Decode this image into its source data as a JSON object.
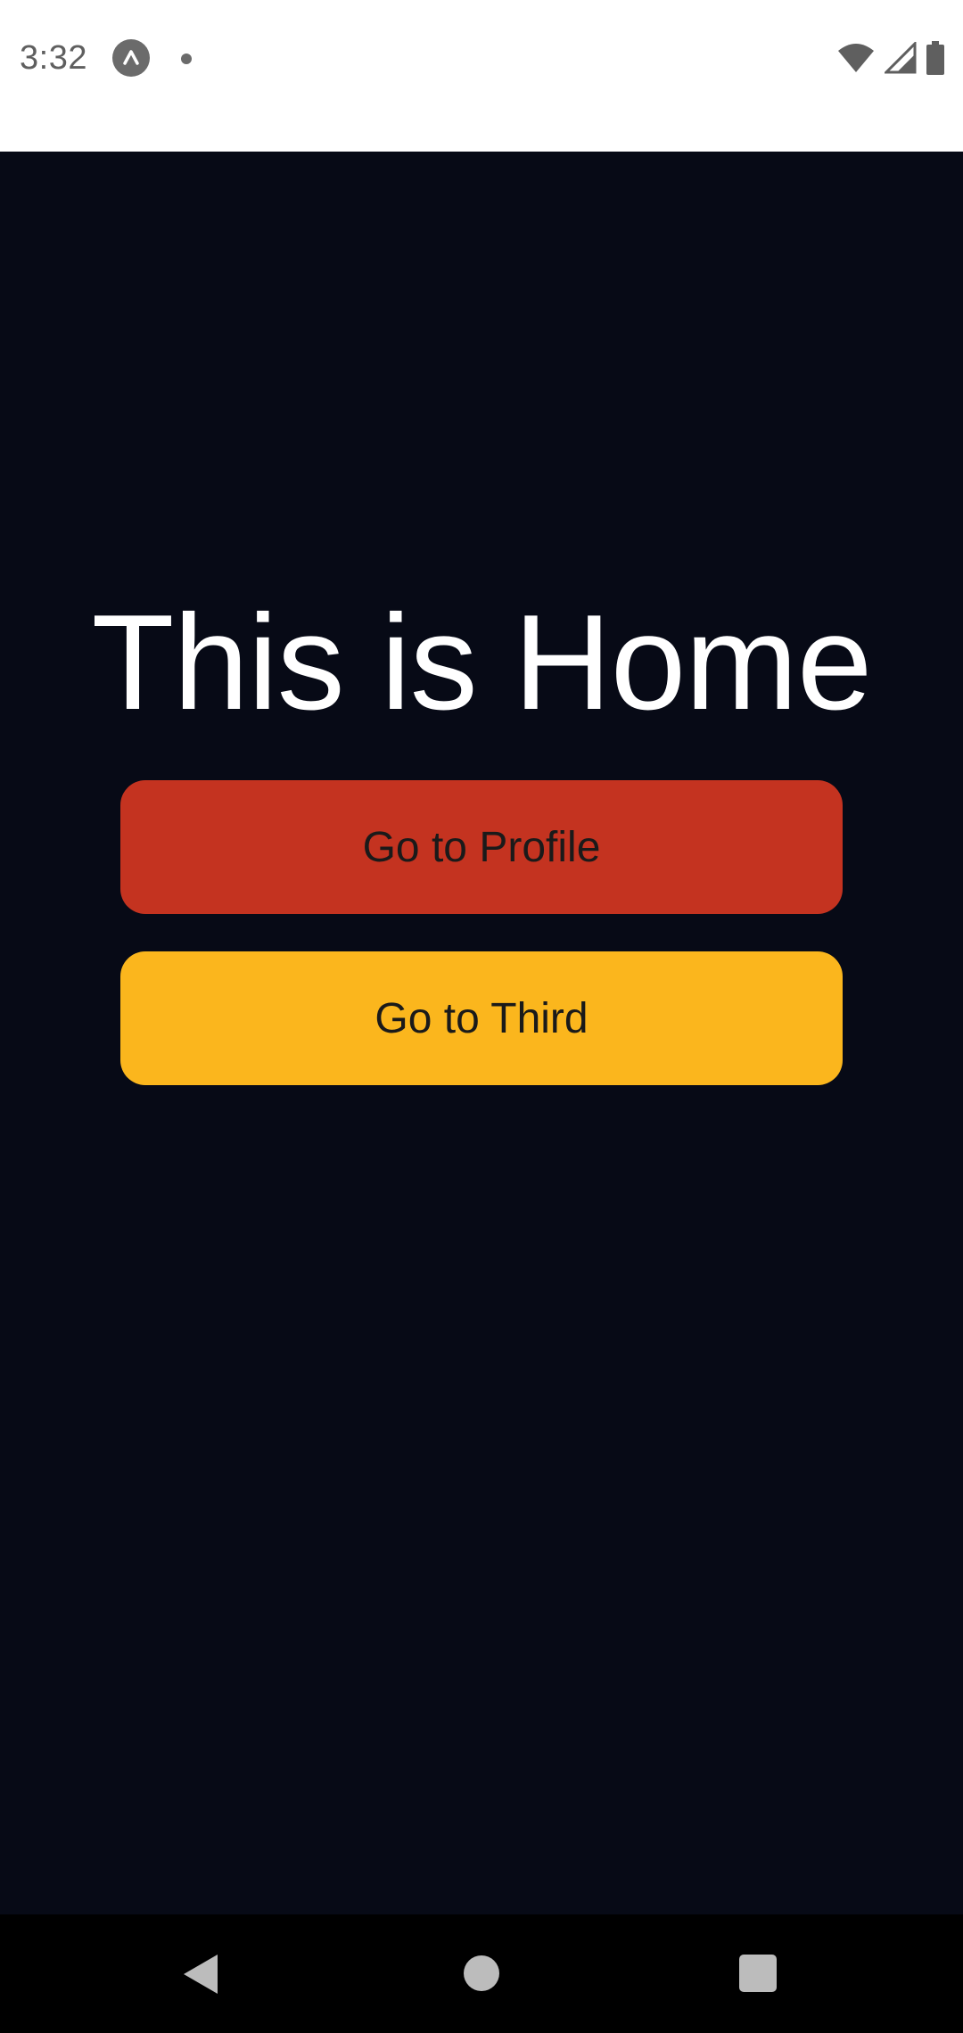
{
  "status_bar": {
    "time": "3:32",
    "icons": [
      "app-notification-icon",
      "dot-icon",
      "wifi-icon",
      "cellular-signal-icon",
      "battery-icon"
    ]
  },
  "main": {
    "title": "This is Home",
    "buttons": {
      "profile_label": "Go to Profile",
      "third_label": "Go to Third"
    }
  },
  "colors": {
    "background": "#070a16",
    "profile_button": "#c43320",
    "third_button": "#fbb61d",
    "title_text": "#ffffff"
  },
  "nav_bar": {
    "icons": [
      "back-icon",
      "home-icon",
      "recents-icon"
    ]
  }
}
